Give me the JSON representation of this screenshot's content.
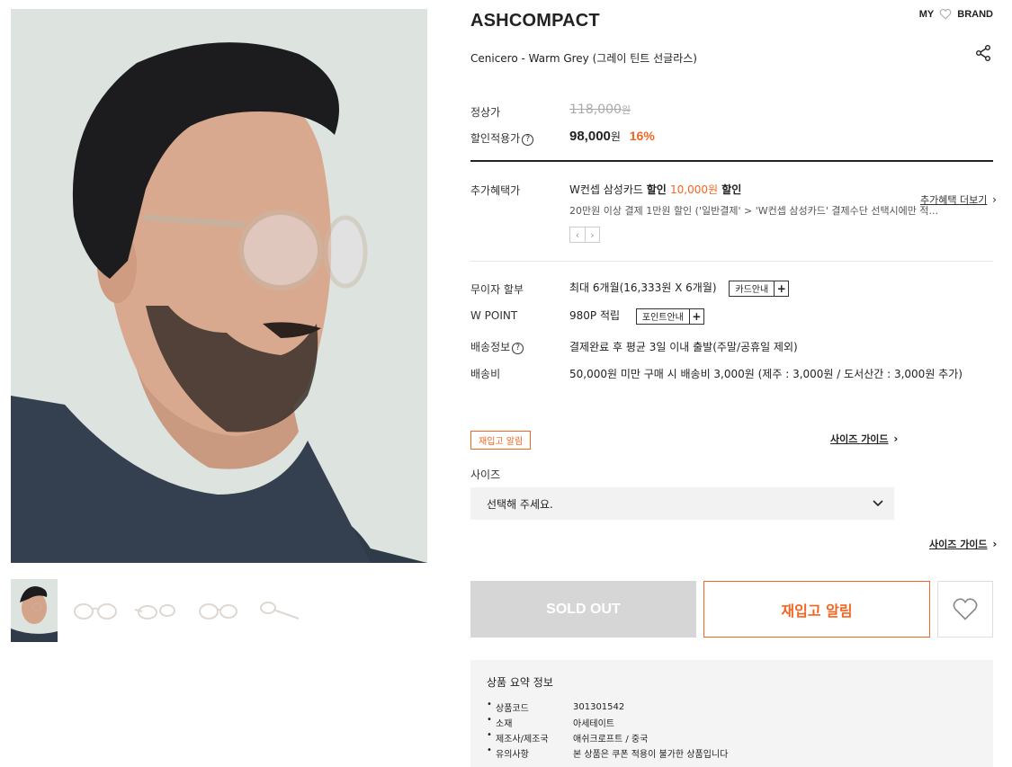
{
  "header": {
    "brand": "ASHCOMPACT",
    "nav_my": "MY",
    "nav_brand": "BRAND",
    "product_name": "Cenicero - Warm Grey (그레이 틴트 선글라스)"
  },
  "price": {
    "regular_label": "정상가",
    "regular_value": "118,000",
    "regular_unit": "원",
    "sale_label": "할인적용가",
    "sale_value": "98,000",
    "sale_unit": "원",
    "discount": "16%"
  },
  "benefit": {
    "label": "추가혜택가",
    "line1_a": "W컨셉 삼성카드 ",
    "line1_b": "할인 ",
    "line1_amount": "10,000원",
    "line1_c": " 할인",
    "line2": "20만원 이상 결제 1만원 할인 ('일반결제' > 'W컨셉 삼성카드' 결제수단 선택시에만 적...",
    "more": "추가혜택 더보기",
    "prev": "‹",
    "next": "›"
  },
  "info": {
    "installment_label": "무이자 할부",
    "installment_value": "최대 6개월(16,333원 X 6개월)",
    "installment_btn": "카드안내",
    "point_label": "W POINT",
    "point_value": "980P 적립",
    "point_btn": "포인트안내",
    "shipping_label": "배송정보",
    "shipping_value": "결제완료 후 평균 3일 이내 출발(주말/공휴일 제외)",
    "fee_label": "배송비",
    "fee_value": "50,000원 미만 구매 시 배송비 3,000원 (제주 : 3,000원 / 도서산간 : 3,000원 추가)",
    "plus": "+",
    "qmark": "?"
  },
  "options": {
    "restock_tag": "재입고 알림",
    "size_guide": "사이즈 가이드",
    "size_label": "사이즈",
    "select_placeholder": "선택해 주세요.",
    "size_guide_2": "사이즈 가이드",
    "chevron": "›"
  },
  "actions": {
    "soldout": "SOLD OUT",
    "restock": "재입고 알림"
  },
  "summary": {
    "title": "상품 요약 정보",
    "rows": [
      {
        "k": "상품코드",
        "v": "301301542"
      },
      {
        "k": "소재",
        "v": "아세테이트"
      },
      {
        "k": "제조사/제조국",
        "v": "애쉬크로프트 / 중국"
      },
      {
        "k": "유의사항",
        "v": "본 상품은 쿠폰 적용이 불가한 상품입니다"
      }
    ]
  },
  "colors": {
    "accent": "#f26522",
    "soldout": "#d6d6d6"
  },
  "icons": [
    "heart-icon",
    "share-icon",
    "question-icon",
    "chevron-down-icon",
    "chevron-right-icon"
  ]
}
